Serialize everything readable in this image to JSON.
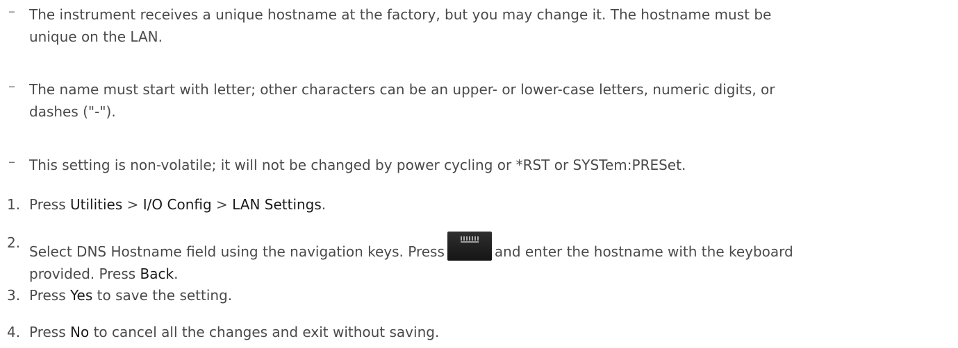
{
  "notes": [
    {
      "marker": "–",
      "lines": [
        "The instrument receives a unique hostname at the factory, but you may change it. The hostname must be",
        "unique on the LAN."
      ]
    },
    {
      "marker": "–",
      "lines": [
        "The name must start with letter; other characters can be an upper- or lower-case letters, numeric digits, or",
        "dashes (\"-\")."
      ]
    },
    {
      "marker": "–",
      "lines": [
        "This setting is non-volatile; it will not be changed by power cycling or *RST or SYSTem:PRESet."
      ]
    }
  ],
  "steps": [
    {
      "number": "1.",
      "press": "Press",
      "menu_1": "Utilities",
      "sep_1": ">",
      "menu_2": "I/O Config",
      "sep_2": ">",
      "menu_3": "LAN Settings",
      "end": "."
    },
    {
      "number": "2.",
      "line1_before": "Select DNS Hostname field using the navigation keys. Press",
      "icon": "keyboard-key-icon",
      "line1_after": "and enter the hostname with the keyboard",
      "line2_before": "provided. Press",
      "key": "Back",
      "end": "."
    },
    {
      "number": "3.",
      "press": "Press",
      "key": "Yes",
      "rest": "to save the setting."
    },
    {
      "number": "4.",
      "press": "Press",
      "key": "No",
      "rest": "to cancel all the changes and exit without saving."
    }
  ]
}
